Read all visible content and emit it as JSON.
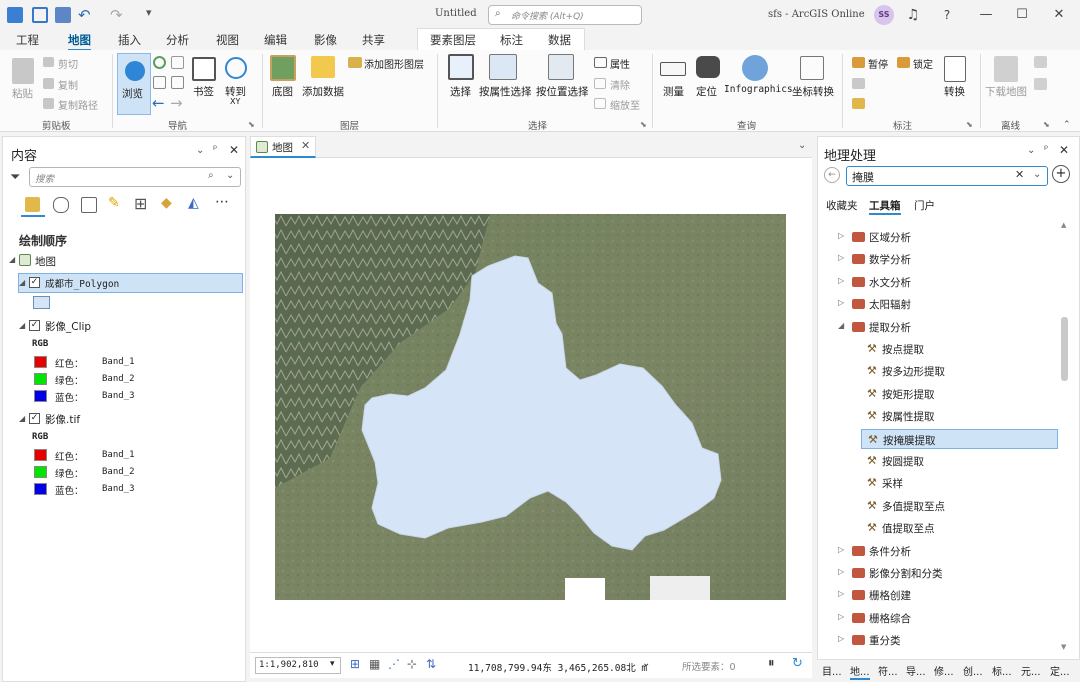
{
  "window": {
    "doc_title": "Untitled",
    "app_title": "sfs - ArcGIS Online",
    "user_initials": "SS"
  },
  "command_search": {
    "placeholder": "命令搜索 (Alt+Q)"
  },
  "tabs": [
    "工程",
    "地图",
    "插入",
    "分析",
    "视图",
    "编辑",
    "影像",
    "共享"
  ],
  "active_tab": "地图",
  "context_tabs": [
    "要素图层",
    "标注",
    "数据"
  ],
  "ribbon": {
    "clipboard": {
      "paste": "粘贴",
      "cut": "剪切",
      "copy": "复制",
      "copy_path": "复制路径",
      "label": "剪贴板"
    },
    "navigate": {
      "explore": "浏览",
      "bookmarks": "书签",
      "goto": "转到",
      "goto_sub": "XY",
      "label": "导航"
    },
    "layer": {
      "basemap": "底图",
      "add_data": "添加数据",
      "add_graphics": "添加图形图层",
      "label": "图层"
    },
    "selection": {
      "select": "选择",
      "by_attr": "按属性选择",
      "by_loc": "按位置选择",
      "attributes": "属性",
      "clear": "清除",
      "zoom_to": "缩放至",
      "label": "选择"
    },
    "inquiry": {
      "measure": "测量",
      "locate": "定位",
      "infographics": "Infographics",
      "coord_conv": "坐标转换",
      "label": "查询"
    },
    "labeling": {
      "pause": "暂停",
      "lock": "锁定",
      "convert": "转换",
      "label": "标注"
    },
    "offline": {
      "download": "下载地图",
      "label": "离线"
    }
  },
  "contents": {
    "title": "内容",
    "search_placeholder": "搜索",
    "draw_order": "绘制顺序",
    "map_label": "地图",
    "layers": [
      {
        "name": "成都市_Polygon"
      },
      {
        "name": "影像_Clip",
        "rgb": "RGB",
        "bands": [
          {
            "color": "红色：",
            "band": "Band_1"
          },
          {
            "color": "绿色：",
            "band": "Band_2"
          },
          {
            "color": "蓝色：",
            "band": "Band_3"
          }
        ]
      },
      {
        "name": "影像.tif",
        "rgb": "RGB",
        "bands": [
          {
            "color": "红色：",
            "band": "Band_1"
          },
          {
            "color": "绿色：",
            "band": "Band_2"
          },
          {
            "color": "蓝色：",
            "band": "Band_3"
          }
        ]
      }
    ],
    "colors": {
      "red": "#e60000",
      "green": "#00e600",
      "blue": "#0000e6"
    }
  },
  "map_view": {
    "tab": "地图",
    "scale": "1:1,902,810",
    "coords": "11,708,799.94东 3,465,265.08北 m",
    "selected": "所选要素：0",
    "polygon_fill": "#d6e4f7"
  },
  "geoprocessing": {
    "title": "地理处理",
    "search_value": "掩膜",
    "nav": [
      "收藏夹",
      "工具箱",
      "门户"
    ],
    "active_nav": "工具箱",
    "items": [
      {
        "label": "区域分析",
        "type": "toolset"
      },
      {
        "label": "数学分析",
        "type": "toolset"
      },
      {
        "label": "水文分析",
        "type": "toolset"
      },
      {
        "label": "太阳辐射",
        "type": "toolset"
      },
      {
        "label": "提取分析",
        "type": "toolset-open"
      },
      {
        "label": "按点提取",
        "type": "tool"
      },
      {
        "label": "按多边形提取",
        "type": "tool"
      },
      {
        "label": "按矩形提取",
        "type": "tool"
      },
      {
        "label": "按属性提取",
        "type": "tool"
      },
      {
        "label": "按掩膜提取",
        "type": "tool-selected"
      },
      {
        "label": "按圆提取",
        "type": "tool"
      },
      {
        "label": "采样",
        "type": "tool"
      },
      {
        "label": "多值提取至点",
        "type": "tool"
      },
      {
        "label": "值提取至点",
        "type": "tool"
      },
      {
        "label": "条件分析",
        "type": "toolset"
      },
      {
        "label": "影像分割和分类",
        "type": "toolset"
      },
      {
        "label": "栅格创建",
        "type": "toolset"
      },
      {
        "label": "栅格综合",
        "type": "toolset"
      },
      {
        "label": "重分类",
        "type": "toolset"
      }
    ]
  },
  "bottom_tabs": [
    "目...",
    "地...",
    "符...",
    "导...",
    "修...",
    "创...",
    "标...",
    "元...",
    "定..."
  ]
}
